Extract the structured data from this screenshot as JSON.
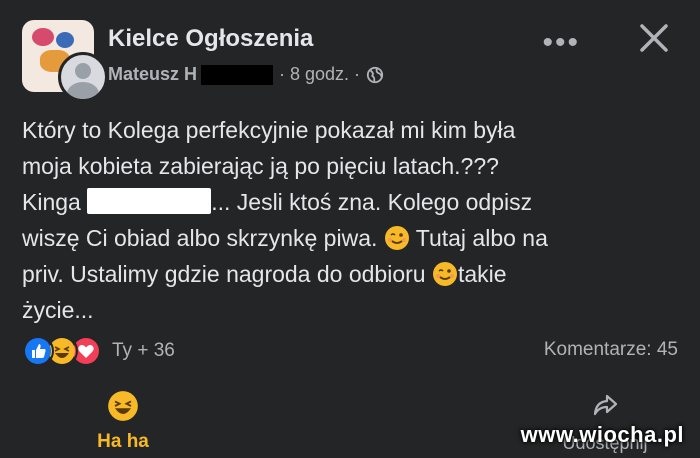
{
  "header": {
    "group_name": "Kielce Ogłoszenia",
    "author": "Mateusz H",
    "time": "· 8 godz. ·",
    "more_label": "•••"
  },
  "post": {
    "line1": "Który to Kolega perfekcyjnie pokazał mi kim była",
    "line2": "moja kobieta zabierając ją po pięciu latach.???",
    "line3_before": "Kinga ",
    "line3_after": "... Jesli ktoś zna. Kolego odpisz",
    "line4_before": "wiszę Ci obiad albo skrzynkę piwa. ",
    "line4_after": " Tutaj albo na",
    "line5_before": "priv. Ustalimy gdzie nagroda do odbioru ",
    "line5_after": "takie",
    "line6": "życie..."
  },
  "reactions": {
    "count_label": "Ty + 36",
    "comments_label": "Komentarze: 45",
    "icons": [
      "like-icon",
      "haha-icon",
      "love-icon"
    ],
    "colors": {
      "like": "#1877f2",
      "haha": "#f7b928",
      "love": "#f33e58"
    }
  },
  "actions": {
    "haha_label": "Ha ha",
    "share_label": "Udostępnij"
  },
  "watermark": "www.wiocha.pl"
}
